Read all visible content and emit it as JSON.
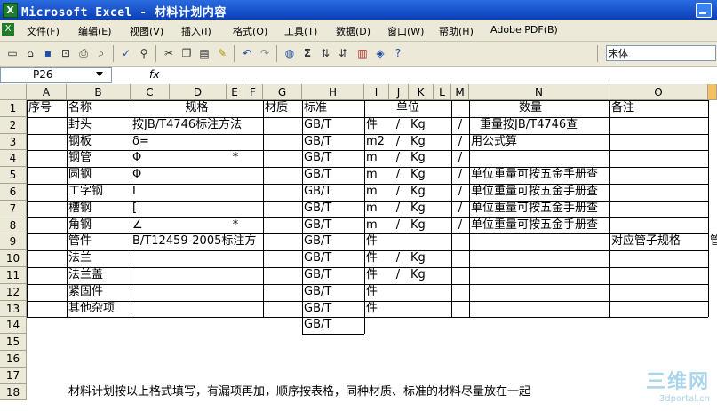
{
  "window": {
    "title": "Microsoft Excel - 材料计划内容"
  },
  "menu": {
    "items": [
      "文件(F)",
      "编辑(E)",
      "视图(V)",
      "插入(I)",
      "格式(O)",
      "工具(T)",
      "数据(D)",
      "窗口(W)",
      "帮助(H)",
      "Adobe PDF(B)"
    ]
  },
  "toolbar": {
    "font_name": "宋体",
    "icons": [
      "new-icon",
      "open-icon",
      "save-icon",
      "permission-icon",
      "print-icon",
      "print-preview-icon",
      "spelling-icon",
      "research-icon",
      "cut-icon",
      "copy-icon",
      "paste-icon",
      "format-painter-icon",
      "undo-icon",
      "redo-icon",
      "hyperlink-icon",
      "autosum-icon",
      "sort-ascending-icon",
      "sort-descending-icon",
      "chart-icon",
      "drawing-icon",
      "help-icon"
    ]
  },
  "formula_bar": {
    "name_box": "P26",
    "fx_label": "fx"
  },
  "sheet": {
    "columns": [
      "A",
      "B",
      "C",
      "D",
      "E",
      "F",
      "G",
      "H",
      "I",
      "J",
      "K",
      "L",
      "M",
      "N",
      "O"
    ],
    "rows": [
      {
        "num": "1",
        "A": "序号",
        "B": "名称",
        "CF": "规格",
        "G": "材质",
        "H": "标准",
        "IL": "单位",
        "MN": "数量",
        "O": "备注"
      },
      {
        "num": "2",
        "B": "封头",
        "CF": "按JB/T4746标注方法",
        "H": "GB/T",
        "I": "件",
        "J": "/",
        "K": "Kg",
        "M": "/",
        "N": "重量按JB/T4746查"
      },
      {
        "num": "3",
        "B": "钢板",
        "CF": "δ=",
        "H": "GB/T",
        "I": "m2",
        "J": "/",
        "K": "Kg",
        "M": "/",
        "N": "用公式算"
      },
      {
        "num": "4",
        "B": "钢管",
        "C": "Φ",
        "E": "*",
        "H": "GB/T",
        "I": "m",
        "J": "/",
        "K": "Kg",
        "M": "/"
      },
      {
        "num": "5",
        "B": "圆钢",
        "C": "Φ",
        "H": "GB/T",
        "I": "m",
        "J": "/",
        "K": "Kg",
        "M": "/",
        "N": "单位重量可按五金手册查"
      },
      {
        "num": "6",
        "B": "工字钢",
        "C": "I",
        "H": "GB/T",
        "I": "m",
        "J": "/",
        "K": "Kg",
        "M": "/",
        "N": "单位重量可按五金手册查"
      },
      {
        "num": "7",
        "B": "槽钢",
        "C": "[",
        "H": "GB/T",
        "I": "m",
        "J": "/",
        "K": "Kg",
        "M": "/",
        "N": "单位重量可按五金手册查"
      },
      {
        "num": "8",
        "B": "角钢",
        "C": "∠",
        "E": "*",
        "H": "GB/T",
        "I": "m",
        "J": "/",
        "K": "Kg",
        "M": "/",
        "N": "单位重量可按五金手册查"
      },
      {
        "num": "9",
        "B": "管件",
        "CF": "B/T12459-2005标注方",
        "H": "GB/T",
        "I": "件",
        "O": "对应管子规格",
        "P": "管"
      },
      {
        "num": "10",
        "B": "法兰",
        "H": "GB/T",
        "I": "件",
        "J": "/",
        "K": "Kg"
      },
      {
        "num": "11",
        "B": "法兰盖",
        "H": "GB/T",
        "I": "件",
        "J": "/",
        "K": "Kg"
      },
      {
        "num": "12",
        "B": "紧固件",
        "H": "GB/T",
        "I": "件"
      },
      {
        "num": "13",
        "B": "其他杂项",
        "H": "GB/T",
        "I": "件"
      },
      {
        "num": "14",
        "H": "GB/T"
      },
      {
        "num": "15"
      },
      {
        "num": "16"
      },
      {
        "num": "17"
      },
      {
        "num": "18",
        "B": "材料计划按以上格式填写，有漏项再加，顺序按表格，同种材质、标准的材料尽量放在一起"
      }
    ]
  },
  "watermark": {
    "big": "三维网",
    "small": "3dportal.cn"
  }
}
